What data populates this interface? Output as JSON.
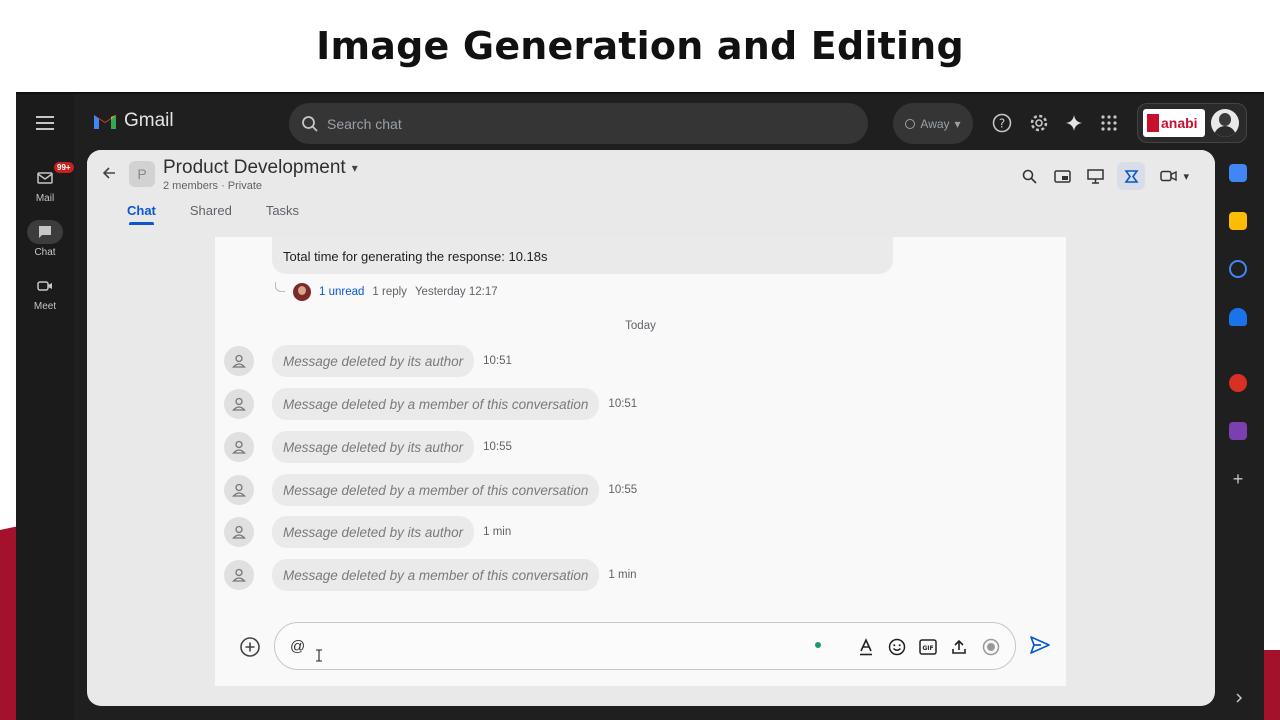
{
  "slide": {
    "title": "Image Generation and Editing"
  },
  "app": {
    "name": "Gmail"
  },
  "left_rail": {
    "items": [
      {
        "label": "Mail",
        "badge": "99+",
        "icon": "mail-icon"
      },
      {
        "label": "Chat",
        "icon": "chat-icon",
        "active": true
      },
      {
        "label": "Meet",
        "icon": "video-icon"
      }
    ]
  },
  "search": {
    "placeholder": "Search chat"
  },
  "status": {
    "label": "Away"
  },
  "account": {
    "org_text": "anabi"
  },
  "space": {
    "initial": "P",
    "title": "Product Development",
    "subtitle": "2 members  ·  Private",
    "tabs": [
      {
        "label": "Chat",
        "active": true
      },
      {
        "label": "Shared",
        "active": false
      },
      {
        "label": "Tasks",
        "active": false
      }
    ]
  },
  "conversation": {
    "previous_message": "Total time for generating the response: 10.18s",
    "thread": {
      "unread": "1 unread",
      "replies": "1 reply",
      "time": "Yesterday 12:17"
    },
    "day_divider": "Today",
    "messages": [
      {
        "text": "Message deleted by its author",
        "time": "10:51"
      },
      {
        "text": "Message deleted by a member of this conversation",
        "time": "10:51"
      },
      {
        "text": "Message deleted by its author",
        "time": "10:55"
      },
      {
        "text": "Message deleted by a member of this conversation",
        "time": "10:55"
      },
      {
        "text": "Message deleted by its author",
        "time": "1 min"
      },
      {
        "text": "Message deleted by a member of this conversation",
        "time": "1 min"
      }
    ]
  },
  "composer": {
    "value": "@"
  },
  "colors": {
    "accent": "#0b57d0",
    "badge": "#c5221f",
    "brand_red": "#c8102e"
  }
}
